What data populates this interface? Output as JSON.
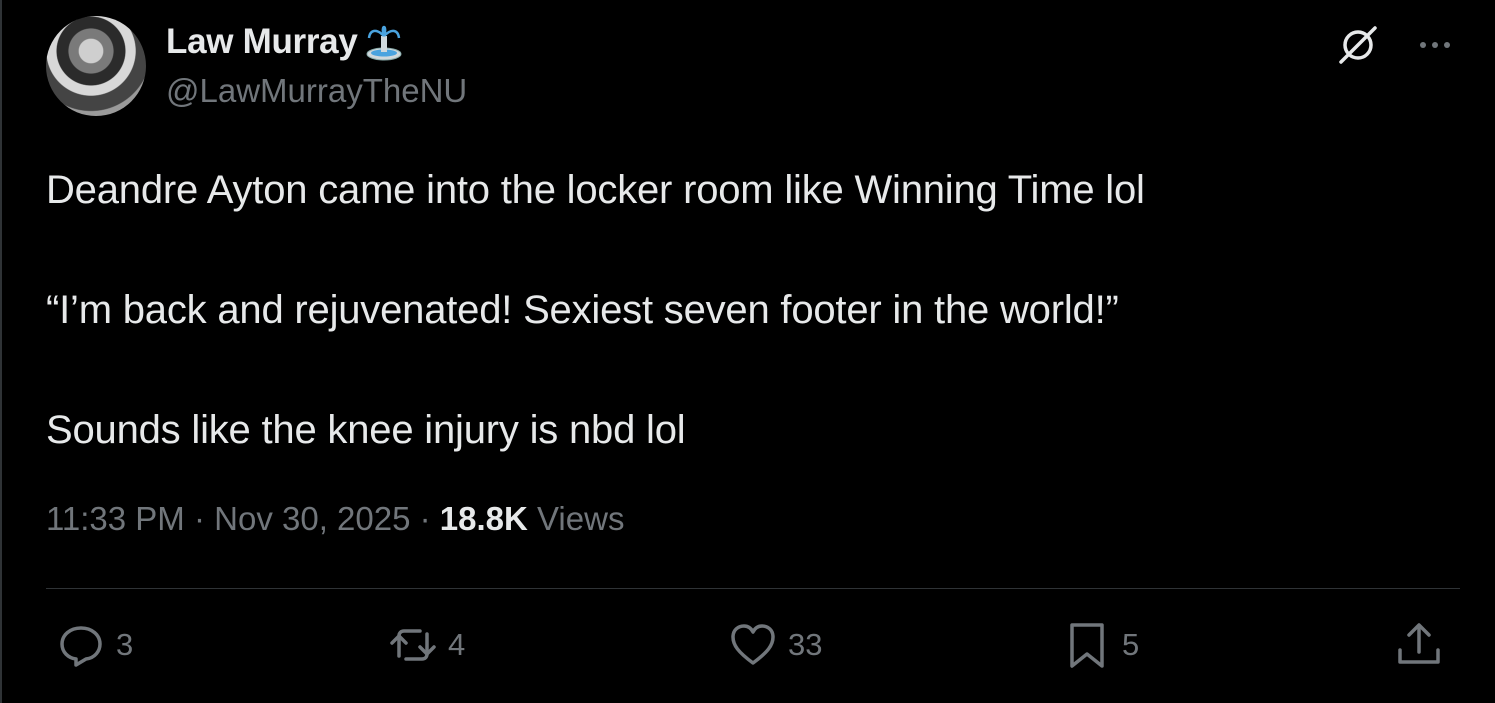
{
  "author": {
    "name": "Law Murray",
    "handle": "@LawMurrayTheNU",
    "badge_icon": "fountain-emoji-icon"
  },
  "tweet": {
    "lines": [
      "Deandre Ayton came into the locker room like Winning Time lol",
      "“I’m back and rejuvenated! Sexiest seven footer in the world!”",
      "Sounds like the knee injury is nbd lol"
    ],
    "time": "11:33 PM",
    "separator": " · ",
    "date": "Nov 30, 2025",
    "views_count": "18.8K",
    "views_label": " Views"
  },
  "actions": {
    "replies": "3",
    "reposts": "4",
    "likes": "33",
    "bookmarks": "5"
  },
  "colors": {
    "background": "#000000",
    "text": "#e7e9ea",
    "secondary": "#71767b",
    "divider": "#2f3336"
  }
}
